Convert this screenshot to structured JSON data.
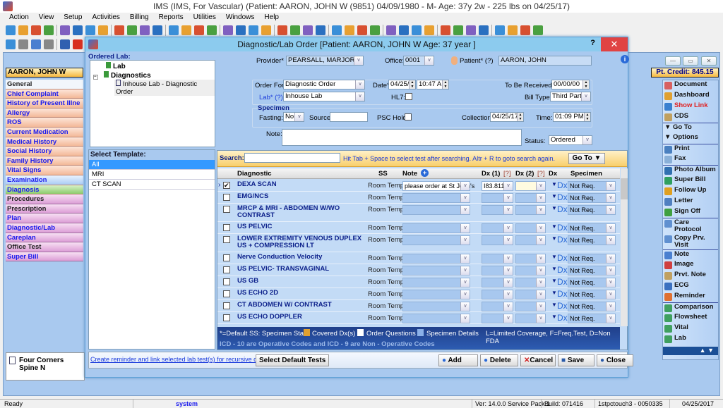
{
  "app": {
    "title": "IMS (IMS, For Vascular)    (Patient: AARON, JOHN W (9851) 04/09/1980 - M- Age: 37y 2w - 225 lbs on 04/25/17)"
  },
  "menu": [
    "Action",
    "View",
    "Setup",
    "Activities",
    "Billing",
    "Reports",
    "Utilities",
    "Windows",
    "Help"
  ],
  "toolbar1": {
    "count": 40,
    "colors": [
      "#3a8fd8",
      "#e8a030",
      "#d85030",
      "#4aa040",
      "#8060c0",
      "#2a70c0"
    ]
  },
  "toolbar2": {
    "count": 6,
    "colors": [
      "#3a8fd8",
      "#888888",
      "#4a7fd0",
      "#888888",
      "#3060b0",
      "#d83020"
    ]
  },
  "patient_bar": "AARON, JOHN W",
  "pt_credit": "Pt. Credit: 845.15",
  "window_buttons": [
    "minimize",
    "restore",
    "close"
  ],
  "sidebar": [
    {
      "label": "General",
      "style": "white"
    },
    {
      "label": "Chief Complaint",
      "style": "orange"
    },
    {
      "label": "History of Present Illne",
      "style": "orange"
    },
    {
      "label": "Allergy",
      "style": "orange"
    },
    {
      "label": "ROS",
      "style": "orange"
    },
    {
      "label": "Current Medication",
      "style": "orange"
    },
    {
      "label": "Medical History",
      "style": "orange"
    },
    {
      "label": "Social History",
      "style": "orange"
    },
    {
      "label": "Family History",
      "style": "orange"
    },
    {
      "label": "Vital Signs",
      "style": "orange"
    },
    {
      "label": "Examination",
      "style": "blue"
    },
    {
      "label": "Diagnosis",
      "style": "green"
    },
    {
      "label": "Procedures",
      "style": "pink dark"
    },
    {
      "label": "Prescription",
      "style": "pink dark"
    },
    {
      "label": "Plan",
      "style": "pink"
    },
    {
      "label": "Diagnostic/Lab",
      "style": "pink"
    },
    {
      "label": "Careplan",
      "style": "pink"
    },
    {
      "label": "Office Test",
      "style": "pink dark"
    },
    {
      "label": "Super Bill",
      "style": "pink"
    }
  ],
  "bottom_doc": "Four Corners Spine N",
  "right_panel": [
    {
      "label": "Document",
      "icon": "document-icon",
      "color": "#d86060"
    },
    {
      "label": "Dashboard",
      "icon": "dashboard-icon",
      "color": "#e0a030"
    },
    {
      "label": "Show Link",
      "icon": "link-icon",
      "color": "#3a80d0",
      "red": true
    },
    {
      "label": "CDS",
      "icon": "cds-icon",
      "color": "#c0a060",
      "sep": true
    },
    {
      "label": "▼ Go To",
      "icon": "",
      "color": ""
    },
    {
      "label": "▼ Options",
      "icon": "",
      "color": "",
      "sep": true
    },
    {
      "label": "Print",
      "icon": "print-icon",
      "color": "#4a80c0"
    },
    {
      "label": "Fax",
      "icon": "fax-icon",
      "color": "#8ab0d8",
      "sep": true
    },
    {
      "label": "Photo Album",
      "icon": "photo-album-icon",
      "color": "#3070b0"
    },
    {
      "label": "Super Bill",
      "icon": "super-bill-icon",
      "color": "#30a060"
    },
    {
      "label": "Follow Up",
      "icon": "follow-up-icon",
      "color": "#e0a020"
    },
    {
      "label": "Letter",
      "icon": "letter-icon",
      "color": "#5080c0"
    },
    {
      "label": "Sign Off",
      "icon": "sign-off-icon",
      "color": "#40a040",
      "sep": true
    },
    {
      "label": "Care Protocol",
      "icon": "care-protocol-icon",
      "color": "#6090d0"
    },
    {
      "label": "Copy Prv. Visit",
      "icon": "copy-visit-icon",
      "color": "#6090d0",
      "sep": true
    },
    {
      "label": "Note",
      "icon": "note-icon",
      "color": "#4a80d0"
    },
    {
      "label": "Image",
      "icon": "image-icon",
      "color": "#d04040"
    },
    {
      "label": "Prvt. Note",
      "icon": "private-note-icon",
      "color": "#c0a060"
    },
    {
      "label": "ECG",
      "icon": "ecg-icon",
      "color": "#3a70c0"
    },
    {
      "label": "Reminder",
      "icon": "reminder-icon",
      "color": "#e07030",
      "sep": true
    },
    {
      "label": "Comparison",
      "icon": "comparison-icon",
      "color": "#40a060"
    },
    {
      "label": "Flowsheet",
      "icon": "flowsheet-icon",
      "color": "#40a060"
    },
    {
      "label": "Vital",
      "icon": "vital-icon",
      "color": "#40a060"
    },
    {
      "label": "Lab",
      "icon": "lab-icon",
      "color": "#40a060"
    }
  ],
  "dialog": {
    "title": "Diagnostic/Lab Order  [Patient: AARON, JOHN W  Age: 37 year ]",
    "help": "?",
    "close": "✕",
    "ordered_lab_label": "Ordered Lab:",
    "tree": {
      "lab": "Lab",
      "diagnostics": "Diagnostics",
      "order": "Inhouse Lab - Diagnostic Order"
    },
    "provider_label": "Provider*",
    "provider": "PEARSALL, MARJORIE",
    "office_label": "Office:",
    "office": "0001",
    "patient_label": "Patient* (?)",
    "patient": "AARON, JOHN",
    "order_for_label": "Order For*",
    "order_for": "Diagnostic Order",
    "date_label": "Date*",
    "date": "04/25/17",
    "time": "10:47 AM",
    "to_be_received_label": "To Be Received:",
    "to_be_received": "00/00/00",
    "lab_label": "Lab* (?)",
    "lab": "Inhouse Lab",
    "hl7_label": "HL7:",
    "bill_type_label": "Bill Type:",
    "bill_type": "Third Party",
    "specimen_label": "Specimen",
    "fasting_label": "Fasting:",
    "fasting": "No",
    "source_label": "Source:",
    "source": "",
    "psc_hold_label": "PSC Hold:",
    "collection_label": "Collection:",
    "collection": "04/25/17",
    "time_label": "Time:",
    "collection_time": "01:09 PM",
    "note_label": "Note:",
    "note": "",
    "status_label": "Status:",
    "status": "Ordered",
    "template_label": "Select Template:",
    "templates": [
      {
        "label": "All",
        "selected": true
      },
      {
        "label": "MRI"
      },
      {
        "label": "CT SCAN"
      }
    ],
    "search_label": "Search:",
    "search_value": "",
    "search_hint": "Hit Tab + Space to select test after searching. Altr + R to goto search again.",
    "goto": "Go To  ▼",
    "columns": {
      "diagnostic": "Diagnostic",
      "ss": "SS",
      "note": "Note",
      "dx1": "Dx (1)",
      "dx1q": "[?]",
      "dx2": "Dx (2)",
      "dx2q": "[?]",
      "dx": "Dx",
      "specimen": "Specimen"
    },
    "rows": [
      {
        "name": "DEXA SCAN",
        "checked": true,
        "current": true,
        "ss": "Room Temp.",
        "note": "please order at St John's",
        "dx1": "I83.811",
        "dx2": "",
        "specimen": "Not Req."
      },
      {
        "name": "EMG/NCS",
        "ss": "Room Temp.",
        "note": "",
        "dx1": "",
        "dx2": "",
        "specimen": "Not Req."
      },
      {
        "name": "MRCP & MRI - ABDOMEN W/WO CONTRAST",
        "two": true,
        "ss": "Room Temp.",
        "note": "",
        "dx1": "",
        "dx2": "",
        "specimen": "Not Req."
      },
      {
        "name": "US PELVIC",
        "ss": "Room Temp.",
        "note": "",
        "dx1": "",
        "dx2": "",
        "specimen": "Not Req."
      },
      {
        "name": "LOWER EXTREMITY VENOUS DUPLEX US + COMPRESSION LT",
        "two": true,
        "ss": "Room Temp.",
        "note": "",
        "dx1": "",
        "dx2": "",
        "specimen": "Not Req."
      },
      {
        "name": "Nerve Conduction Velocity",
        "ss": "Room Temp.",
        "note": "",
        "dx1": "",
        "dx2": "",
        "specimen": "Not Req."
      },
      {
        "name": "US PELVIC- TRANSVAGINAL",
        "ss": "Room Temp.",
        "note": "",
        "dx1": "",
        "dx2": "",
        "specimen": "Not Req."
      },
      {
        "name": "US GB",
        "ss": "Room Temp.",
        "note": "",
        "dx1": "",
        "dx2": "",
        "specimen": "Not Req."
      },
      {
        "name": "US ECHO 2D",
        "ss": "Room Temp.",
        "note": "",
        "dx1": "",
        "dx2": "",
        "specimen": "Not Req."
      },
      {
        "name": "CT ABDOMEN W/ CONTRAST",
        "ss": "Room Temp.",
        "note": "",
        "dx1": "",
        "dx2": "",
        "specimen": "Not Req."
      },
      {
        "name": "US ECHO DOPPLER",
        "ss": "Room Temp.",
        "note": "",
        "dx1": "",
        "dx2": "",
        "specimen": "Not Req."
      }
    ],
    "legend": {
      "default": "*=Default   SS: Specimen State",
      "covered": "Covered Dx(s)",
      "questions": "Order Questions",
      "details": "Specimen Details",
      "codes": "L=Limited Coverage, F=Freq.Test, D=Non FDA",
      "icd": "ICD - 10 are Operative Codes and ICD - 9 are Non - Operative Codes"
    },
    "reminder_link": "Create reminder and link selected lab test(s) for recursive order.",
    "buttons": {
      "default_tests": "Select Default Tests",
      "add": "Add",
      "delete": "Delete",
      "cancel": "Cancel",
      "save": "Save",
      "close": "Close"
    }
  },
  "status_bar": {
    "ready": "Ready",
    "user": "system",
    "version": "Ver: 14.0.0 Service Pack 1",
    "build": "Build: 071416",
    "station": "1stpctouch3 - 0050335",
    "date": "04/25/2017"
  }
}
